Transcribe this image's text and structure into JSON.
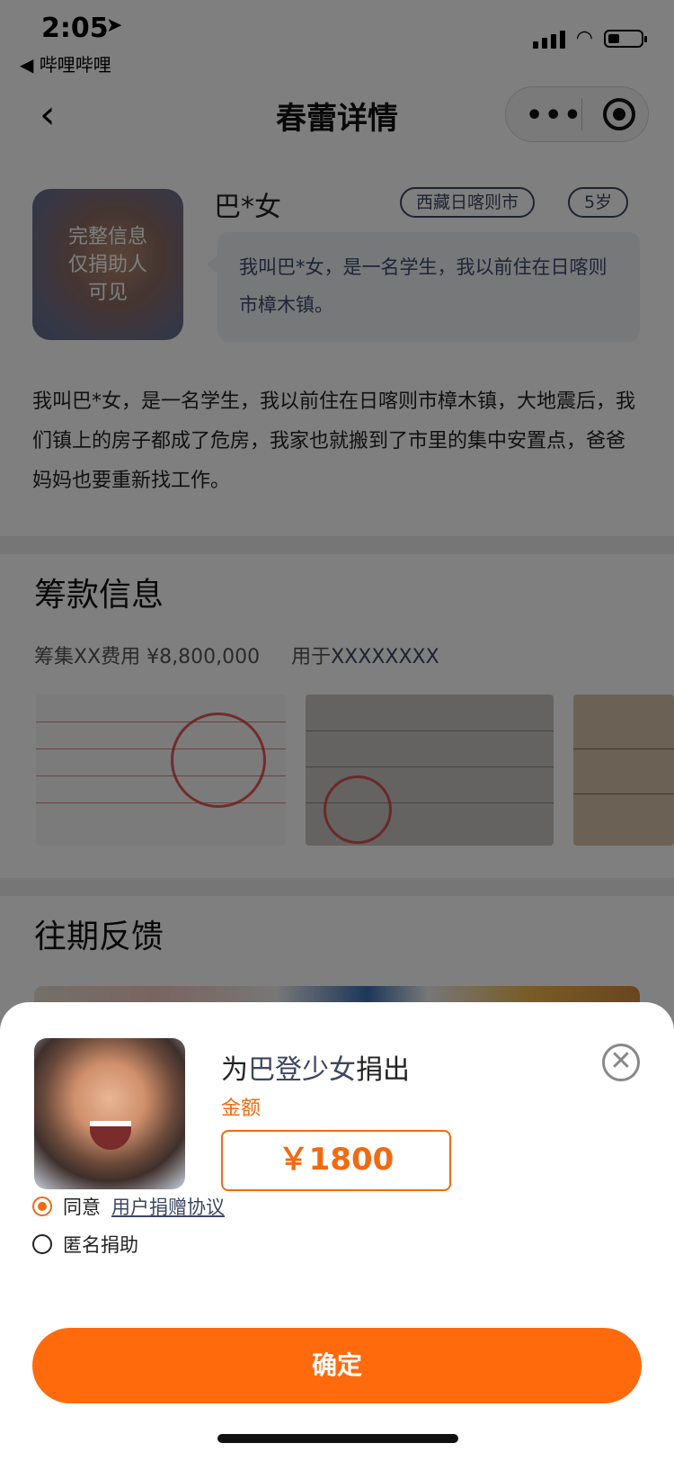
{
  "status": {
    "time": "2:05",
    "back_app": "◀ 哔哩哔哩"
  },
  "nav": {
    "title": "春蕾详情",
    "more": "•••"
  },
  "profile": {
    "avatar_overlay": [
      "完整信息",
      "仅捐助人",
      "可见"
    ],
    "name": "巴*女",
    "tags": [
      "西藏日喀则市",
      "5岁"
    ],
    "intro": "我叫巴*女，是一名学生，我以前住在日喀则市樟木镇。",
    "story": "我叫巴*女，是一名学生，我以前住在日喀则市樟木镇，大地震后，我们镇上的房子都成了危房，我家也就搬到了市里的集中安置点，爸爸妈妈也要重新找工作。"
  },
  "fund": {
    "title": "筹款信息",
    "label": "筹集XX费用",
    "amount": "¥8,800,000",
    "use_label": "用于",
    "use_value": "XXXXXXXX"
  },
  "feedback": {
    "title": "往期反馈"
  },
  "sheet": {
    "title_prefix": "为",
    "title_name": "巴登少女",
    "title_suffix": "捐出",
    "amount_label": "金额",
    "amount_value": "￥1800",
    "close_glyph": "✕",
    "agree_label": "同意",
    "agree_link": "用户捐赠协议",
    "anonymous_label": "匿名捐助",
    "confirm": "确定"
  },
  "colors": {
    "accent": "#ff6a0d",
    "link_blue": "#3c4660"
  }
}
